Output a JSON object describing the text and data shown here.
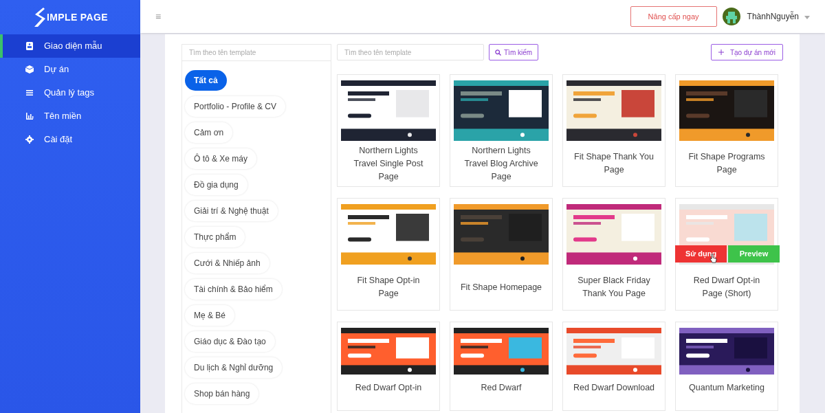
{
  "sidebar": {
    "logo_text": "IMPLE PAGE",
    "items": [
      {
        "label": "Giao diện mẫu",
        "selected": true
      },
      {
        "label": "Dự án",
        "selected": false
      },
      {
        "label": "Quản lý tags",
        "selected": false
      },
      {
        "label": "Tên miền",
        "selected": false
      },
      {
        "label": "Cài đặt",
        "selected": false
      }
    ]
  },
  "header": {
    "menu_icon": "≡",
    "upgrade_button": "Nâng cấp ngay",
    "user_name": "ThànhNguyễn"
  },
  "category_search": {
    "placeholder": "Tìm theo tên template"
  },
  "categories": [
    {
      "label": "Tất cả",
      "selected": true
    },
    {
      "label": "Portfolio - Profile & CV",
      "selected": false
    },
    {
      "label": "Cảm ơn",
      "selected": false
    },
    {
      "label": "Ô tô & Xe máy",
      "selected": false
    },
    {
      "label": "Đồ gia dụng",
      "selected": false
    },
    {
      "label": "Giải trí & Nghệ thuật",
      "selected": false
    },
    {
      "label": "Thực phẩm",
      "selected": false
    },
    {
      "label": "Cưới & Nhiếp ảnh",
      "selected": false
    },
    {
      "label": "Tài chính & Bảo hiểm",
      "selected": false
    },
    {
      "label": "Mẹ & Bé",
      "selected": false
    },
    {
      "label": "Giáo dục & Đào tạo",
      "selected": false
    },
    {
      "label": "Du lịch & Nghỉ dưỡng",
      "selected": false
    },
    {
      "label": "Shop bán hàng",
      "selected": false
    }
  ],
  "template_search": {
    "placeholder": "Tìm theo tên template",
    "button": "Tìm kiếm"
  },
  "new_project_button": "Tạo dự án mới",
  "templates": [
    {
      "title": "Northern Lights Travel Single Post Page",
      "hovered": false
    },
    {
      "title": "Northern Lights Travel Blog Archive Page",
      "hovered": false
    },
    {
      "title": "Fit Shape Thank You Page",
      "hovered": false
    },
    {
      "title": "Fit Shape Programs Page",
      "hovered": false
    },
    {
      "title": "Fit Shape Opt-in Page",
      "hovered": false
    },
    {
      "title": "Fit Shape Homepage",
      "hovered": false
    },
    {
      "title": "Super Black Friday Thank You Page",
      "hovered": false
    },
    {
      "title": "Red Dwarf Opt-in Page (Short)",
      "hovered": true
    },
    {
      "title": "Red Dwarf Opt-in",
      "hovered": false
    },
    {
      "title": "Red Dwarf",
      "hovered": false
    },
    {
      "title": "Red Dwarf Download",
      "hovered": false
    },
    {
      "title": "Quantum Marketing",
      "hovered": false
    }
  ],
  "card_actions": {
    "use": "Sử dụng",
    "preview": "Preview"
  }
}
